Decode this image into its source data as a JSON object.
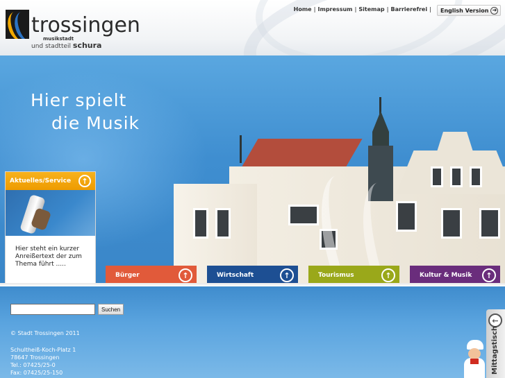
{
  "header": {
    "logo": {
      "title": "trossingen",
      "subtitle": "musikstadt",
      "tagline_prefix": "und stadtteil",
      "tagline_bold": "schura"
    },
    "topnav": [
      {
        "label": "Home"
      },
      {
        "label": "Impressum"
      },
      {
        "label": "Sitemap"
      },
      {
        "label": "Barrierefrei"
      }
    ],
    "english_button": "English Version"
  },
  "hero": {
    "title_line1": "Hier spielt",
    "title_line2": "die Musik"
  },
  "news_box": {
    "heading": "Aktuelles/Service",
    "teaser": "Hier steht ein kurzer Anreißertext der zum Thema führt ....."
  },
  "categories": [
    {
      "label": "Bürger",
      "color": "#e15a3a"
    },
    {
      "label": "Wirtschaft",
      "color": "#1d4f93"
    },
    {
      "label": "Tourismus",
      "color": "#9aa81a"
    },
    {
      "label": "Kultur & Musik",
      "color": "#6a2d7c"
    }
  ],
  "search": {
    "value": "",
    "placeholder": "",
    "button": "Suchen"
  },
  "footer": {
    "copyright": "© Stadt Trossingen 2011",
    "address": [
      "Schultheiß-Koch-Platz 1",
      "78647 Trossingen",
      "Tel.: 07425/25-0",
      "Fax: 07425/25-150"
    ]
  },
  "side_tab": {
    "label": "Mittagstisch"
  },
  "colors": {
    "brand_orange": "#f0a00a",
    "sky_blue": "#3f8ed0"
  }
}
